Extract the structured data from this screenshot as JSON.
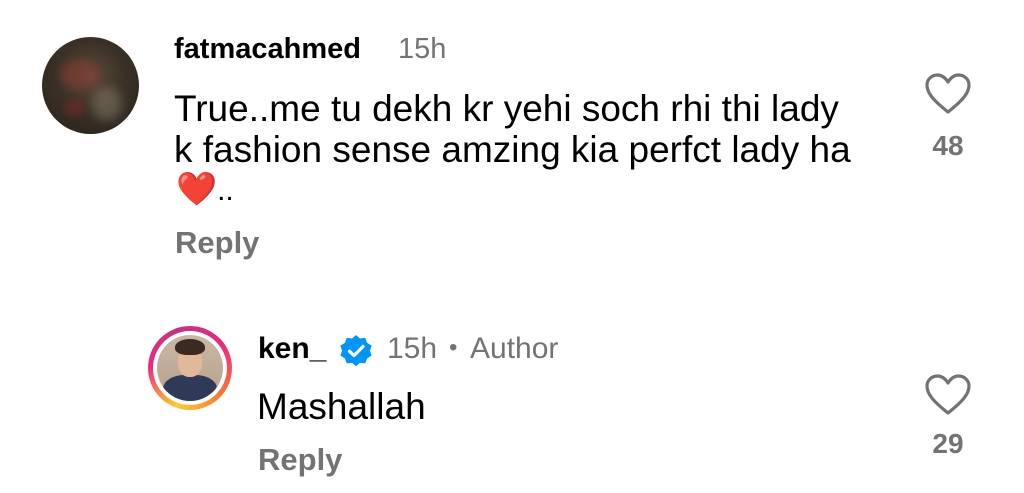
{
  "comment": {
    "username": "fatmacahmed",
    "time": "15h",
    "text_line1": "True..me tu dekh kr yehi soch rhi thi lady",
    "text_line2": "k fashion sense amzing kia perfct lady ha",
    "text_line3_emoji": "❤️",
    "text_line3_suffix": "..",
    "reply_label": "Reply",
    "like_count": "48"
  },
  "reply": {
    "username": "ken_",
    "time": "15h",
    "separator": "•",
    "author_label": "Author",
    "text": "Mashallah",
    "reply_label": "Reply",
    "like_count": "29"
  },
  "colors": {
    "text": "#000000",
    "muted": "#737373",
    "verified": "#0095f6",
    "heart_emoji": "#e8192c"
  },
  "icons": {
    "like": "heart-outline-icon",
    "verified": "verified-badge-icon"
  }
}
